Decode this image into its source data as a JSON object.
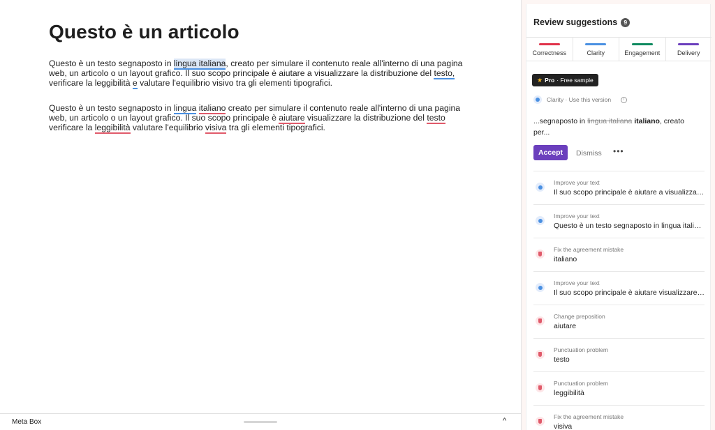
{
  "editor": {
    "title": "Questo è un articolo",
    "p1": {
      "t1": "Questo è un testo segnaposto in ",
      "u1": "lingua italiana",
      "t2": ", creato per simulare il contenuto reale all'interno di una pagina web, un articolo o un layout grafico. Il suo scopo principale è aiutare a visualizzare la distribuzione del ",
      "u2": "testo,",
      "t3": " verificare la leggibilità ",
      "u3": "e",
      "t4": " valutare l'equilibrio visivo tra gli elementi tipografici."
    },
    "p2": {
      "t1": "Questo è un testo segnaposto in ",
      "u1": "lingua",
      "t2": " ",
      "u2": "italiano",
      "t3": " creato per simulare il contenuto reale all'interno di una pagina web, un articolo o un layout grafico. Il suo scopo principale è ",
      "u3": "aiutare",
      "t4": " visualizzare la distribuzione del ",
      "u4": "testo",
      "t5": " verificare la ",
      "u5": "leggibilità",
      "t6": " valutare l'equilibrio ",
      "u6": "visiva",
      "t7": " tra gli elementi tipografici."
    }
  },
  "meta_box": {
    "label": "Meta Box",
    "chevron": "^"
  },
  "panel": {
    "title": "Review suggestions",
    "count": "9",
    "categories": [
      {
        "label": "Correctness",
        "color": "#e0324a"
      },
      {
        "label": "Clarity",
        "color": "#4a90e2"
      },
      {
        "label": "Engagement",
        "color": "#0f8a5f"
      },
      {
        "label": "Delivery",
        "color": "#6b3fbd"
      }
    ],
    "pro_badge": {
      "star": "★",
      "pro": "Pro",
      "rest": "· Free sample"
    },
    "clarity_line": "Clarity · Use this version",
    "info": "i",
    "snippet": {
      "before": "...segnaposto in ",
      "strike": "lingua italiana",
      "bold": "italiano",
      "after": ", creato per..."
    },
    "accept_label": "Accept",
    "dismiss_label": "Dismiss",
    "more": "•••",
    "suggestions": [
      {
        "kind": "Improve your text",
        "text": "Il suo scopo principale è aiutare a visualizzare la distribuzione del testo",
        "icon": "clarity-icon"
      },
      {
        "kind": "Improve your text",
        "text": "Questo è un testo segnaposto in lingua italiano creato per simulare",
        "icon": "clarity-icon"
      },
      {
        "kind": "Fix the agreement mistake",
        "text": "italiano",
        "icon": "correctness-icon"
      },
      {
        "kind": "Improve your text",
        "text": "Il suo scopo principale è aiutare visualizzare la distribuzione",
        "icon": "clarity-icon"
      },
      {
        "kind": "Change preposition",
        "text": "aiutare",
        "icon": "correctness-icon"
      },
      {
        "kind": "Punctuation problem",
        "text": "testo",
        "icon": "correctness-icon"
      },
      {
        "kind": "Punctuation problem",
        "text": "leggibilità",
        "icon": "correctness-icon"
      },
      {
        "kind": "Fix the agreement mistake",
        "text": "visiva",
        "icon": "correctness-icon"
      }
    ]
  }
}
